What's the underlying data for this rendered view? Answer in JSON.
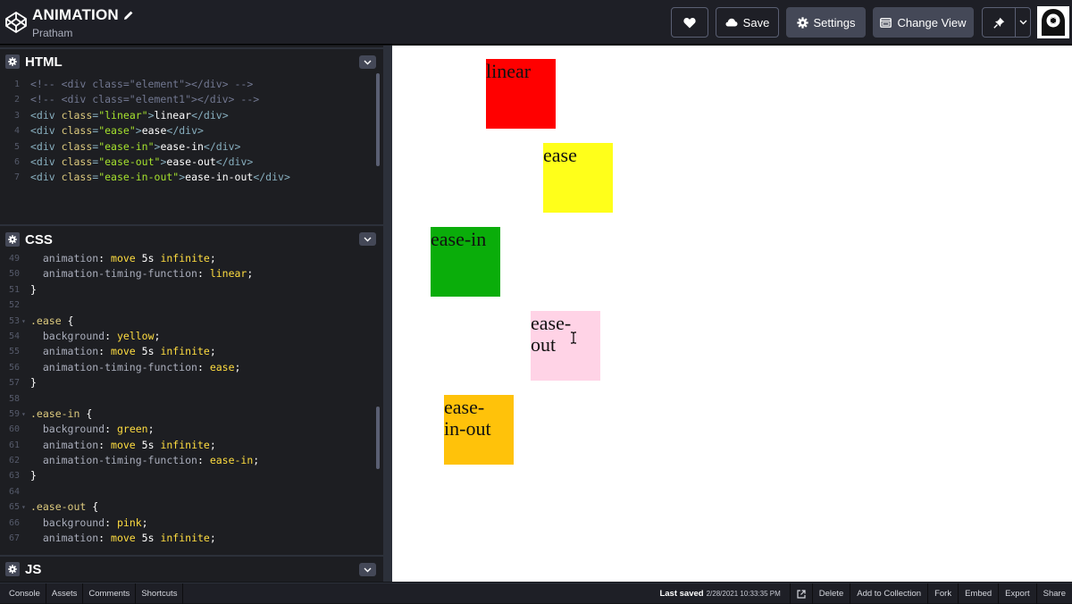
{
  "header": {
    "title": "ANIMATION",
    "author": "Pratham",
    "buttons": {
      "save": "Save",
      "settings": "Settings",
      "change_view": "Change View"
    }
  },
  "panels": {
    "html": {
      "title": "HTML"
    },
    "css": {
      "title": "CSS"
    },
    "js": {
      "title": "JS"
    }
  },
  "html_code": [
    {
      "n": "1",
      "text": "<!-- <div class=\"element\"></div> -->"
    },
    {
      "n": "2",
      "text": "<!-- <div class=\"element1\"></div> -->"
    },
    {
      "n": "3",
      "text": "<div class=\"linear\">linear</div>"
    },
    {
      "n": "4",
      "text": "<div class=\"ease\">ease</div>"
    },
    {
      "n": "5",
      "text": "<div class=\"ease-in\">ease-in</div>"
    },
    {
      "n": "6",
      "text": "<div class=\"ease-out\">ease-out</div>"
    },
    {
      "n": "7",
      "text": "<div class=\"ease-in-out\">ease-in-out</div>"
    }
  ],
  "css_code": [
    {
      "n": "49",
      "text": "  animation: move 5s infinite;"
    },
    {
      "n": "50",
      "text": "  animation-timing-function: linear;"
    },
    {
      "n": "51",
      "text": "}"
    },
    {
      "n": "52",
      "text": ""
    },
    {
      "n": "53",
      "text": ".ease {",
      "fold": true
    },
    {
      "n": "54",
      "text": "  background: yellow;"
    },
    {
      "n": "55",
      "text": "  animation: move 5s infinite;"
    },
    {
      "n": "56",
      "text": "  animation-timing-function: ease;"
    },
    {
      "n": "57",
      "text": "}"
    },
    {
      "n": "58",
      "text": ""
    },
    {
      "n": "59",
      "text": ".ease-in {",
      "fold": true
    },
    {
      "n": "60",
      "text": "  background: green;"
    },
    {
      "n": "61",
      "text": "  animation: move 5s infinite;"
    },
    {
      "n": "62",
      "text": "  animation-timing-function: ease-in;"
    },
    {
      "n": "63",
      "text": "}"
    },
    {
      "n": "64",
      "text": ""
    },
    {
      "n": "65",
      "text": ".ease-out {",
      "fold": true
    },
    {
      "n": "66",
      "text": "  background: pink;"
    },
    {
      "n": "67",
      "text": "  animation: move 5s infinite;"
    }
  ],
  "preview": {
    "boxes": [
      {
        "label": "linear",
        "color": "#ff0000"
      },
      {
        "label": "ease",
        "color": "#ffff1a"
      },
      {
        "label": "ease-in",
        "color": "#0aad0a"
      },
      {
        "label": "ease-out",
        "color": "#ffd3e6"
      },
      {
        "label": "ease-in-out",
        "color": "#ffc20a"
      }
    ]
  },
  "footer": {
    "left": [
      "Console",
      "Assets",
      "Comments",
      "Shortcuts"
    ],
    "last_saved_label": "Last saved",
    "last_saved_time": "2/28/2021 10:33:35 PM",
    "right": [
      "Delete",
      "Add to Collection",
      "Fork",
      "Embed",
      "Export",
      "Share"
    ]
  },
  "icons": [
    "codepen-logo-icon",
    "pencil-icon",
    "heart-icon",
    "cloud-icon",
    "gear-icon",
    "layout-icon",
    "pin-icon",
    "chevron-down-icon",
    "external-link-icon",
    "avatar"
  ],
  "colors": {
    "header_bg": "#1e1f26",
    "editor_bg": "#1d1e22",
    "button_bg": "#444857",
    "preview_bg": "#ffffff"
  }
}
